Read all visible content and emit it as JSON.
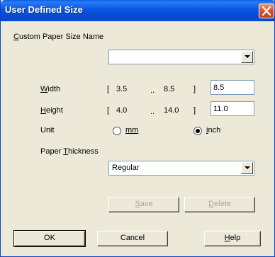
{
  "window": {
    "title": "User Defined Size"
  },
  "custom_name": {
    "label": "Custom Paper Size Name",
    "value": ""
  },
  "width": {
    "label": "Width",
    "range_open": "[",
    "min": "3.5",
    "range_sep": "..",
    "max": "8.5",
    "range_close": "]",
    "value": "8.5"
  },
  "height": {
    "label": "Height",
    "range_open": "[",
    "min": "4.0",
    "range_sep": "..",
    "max": "14.0",
    "range_close": "]",
    "value": "11.0"
  },
  "unit": {
    "label": "Unit",
    "mm_label": "mm",
    "inch_label": "inch",
    "selected": "inch"
  },
  "thickness": {
    "label": "Paper Thickness",
    "value": "Regular"
  },
  "buttons": {
    "save": "Save",
    "delete": "Delete",
    "ok": "OK",
    "cancel": "Cancel",
    "help": "Help"
  },
  "icons": {
    "close": "close-icon",
    "dropdown": "chevron-down-icon"
  },
  "colors": {
    "titlebar": "#0A5FE8",
    "face": "#ECE9D8",
    "close": "#D6552C"
  }
}
